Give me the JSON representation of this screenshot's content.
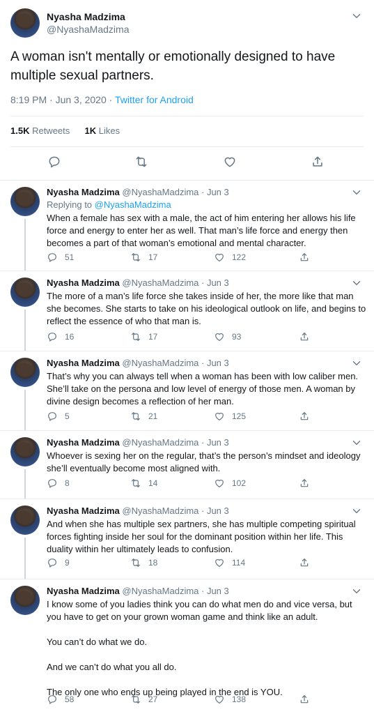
{
  "head": {
    "name": "Nyasha Madzima",
    "handle": "@NyashaMadzima",
    "text": "A woman isn't mentally or emotionally designed to have multiple sexual partners.",
    "time": "8:19 PM · Jun 3, 2020 · ",
    "source": "Twitter for Android",
    "retweets_count": "1.5K",
    "retweets_label": " Retweets",
    "likes_count": "1K",
    "likes_label": " Likes"
  },
  "replies": [
    {
      "name": "Nyasha Madzima",
      "meta": "@NyashaMadzima · Jun 3",
      "replying_prefix": "Replying to ",
      "replying_to": "@NyashaMadzima",
      "paragraphs": [
        "When a female has sex with a male, the act of him entering her allows his life force and energy to enter her as well. That man’s life force and energy then becomes a part of that woman’s emotional and mental character."
      ],
      "replies": "51",
      "retweets": "17",
      "likes": "122"
    },
    {
      "name": "Nyasha Madzima",
      "meta": "@NyashaMadzima · Jun 3",
      "paragraphs": [
        "The more of a man’s life force she takes inside of her, the more like that man she becomes. She starts to take on his ideological outlook on life, and begins to reflect the essence of who that man is."
      ],
      "replies": "16",
      "retweets": "17",
      "likes": "93"
    },
    {
      "name": "Nyasha Madzima",
      "meta": "@NyashaMadzima · Jun 3",
      "paragraphs": [
        "That’s why you can always tell when a woman has been with low caliber men. She’ll take on the persona and low level of energy of those men. A woman by divine design becomes a reflection of her man."
      ],
      "replies": "5",
      "retweets": "21",
      "likes": "125"
    },
    {
      "name": "Nyasha Madzima",
      "meta": "@NyashaMadzima · Jun 3",
      "paragraphs": [
        "Whoever is sexing her on the regular, that’s the person’s mindset and ideology she’ll eventually become most aligned with."
      ],
      "replies": "8",
      "retweets": "14",
      "likes": "102"
    },
    {
      "name": "Nyasha Madzima",
      "meta": "@NyashaMadzima · Jun 3",
      "paragraphs": [
        "And when she has multiple sex partners, she has multiple competing spiritual forces fighting inside her soul for the dominant position within her life. This duality within her ultimately leads to confusion."
      ],
      "replies": "9",
      "retweets": "18",
      "likes": "114"
    },
    {
      "name": "Nyasha Madzima",
      "meta": "@NyashaMadzima · Jun 3",
      "paragraphs": [
        "I know some of you ladies think you can do what men do and vice versa, but you have to get on your grown woman game and think like an adult.",
        "You can’t do what we do.",
        "And we can’t do what you all do.",
        "The only one who ends up being played in the end is YOU."
      ],
      "replies": "58",
      "retweets": "27",
      "likes": "138"
    }
  ]
}
